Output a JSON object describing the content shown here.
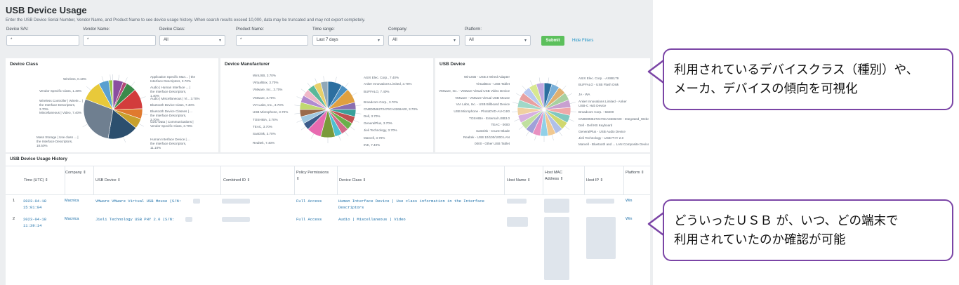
{
  "page": {
    "title": "USB Device Usage",
    "description": "Enter the USB Device Serial Number, Vendor Name, and Product Name to see device usage history. When search results exceed 10,000, data may be truncated and may not export completely."
  },
  "filters": {
    "device_sn": {
      "label": "Device S/N:",
      "value": "*"
    },
    "vendor_name": {
      "label": "Vendor Name:",
      "value": "*"
    },
    "device_class": {
      "label": "Device Class:",
      "value": "All"
    },
    "product_name": {
      "label": "Product Name:",
      "value": "*"
    },
    "time_range": {
      "label": "Time range:",
      "value": "Last 7 days"
    },
    "company": {
      "label": "Company:",
      "value": "All"
    },
    "platform": {
      "label": "Platform:",
      "value": "All"
    },
    "submit_label": "Submit",
    "hide_filters_label": "Hide Filters"
  },
  "panels": {
    "device_class": {
      "title": "Device Class",
      "left_labels": [
        "Wireless, 0.18%",
        "Vendor Specific Class, 1.40%",
        "Wireless Controller | Wirele... | the Interface Descriptors, 3.70%",
        "Miscellaneous | Video, 7.40%",
        "Mass Storage | Use class ... | the Interface Descriptors, 18.50%"
      ],
      "right_labels": [
        "Application Specific Man... | the Interface Descriptors, 3.70%",
        "Audio | Human Interface ... | the Interface Descriptors, 1.40%",
        "Audio | Miscellaneous | Vi... 3.70%",
        "Bluetooth Device Class, 7.40%",
        "Bluetooth Device Classes | ... the Interface Descriptors, 3.70%",
        "CDC-Data | Communications | Vendor Specific Class, 3.70%",
        "Human Interface Device | ... the Interface Descriptors, 11.10%"
      ]
    },
    "device_manufacturer": {
      "title": "Device Manufacturer",
      "left_labels": [
        "WinUSB, 3.70%",
        "VirtualBox, 3.70%",
        "VMware, Inc., 3.70%",
        "VMware, 3.70%",
        "VIA Labs, Inc., 3.70%",
        "USB Microphone, 3.70%",
        "TOSHIBA, 3.70%",
        "TEAC, 3.70%",
        "SanDisk, 3.70%",
        "Realtek, 7.40%"
      ],
      "right_labels": [
        "ASIX Elec. Corp., 7.40%",
        "Anker Innovations Limited, 3.70%",
        "BUFFALO, 7.40%",
        "Broadcom Corp., 3.70%",
        "CN0D0M6272476CA3266A00, 3.70%",
        "Dell, 3.70%",
        "GeneralPlus, 3.70%",
        "Jieli Technology, 3.70%",
        "Marvell, 3.70%",
        "INK, 7.40%"
      ]
    },
    "usb_device": {
      "title": "USB Device",
      "left_labels": [
        "WinUSB - USB 2 Wired Adapter",
        "VirtualBox - USB Tablet",
        "VMware, Inc. - VMware Virtual USB Video Device",
        "VMware - VMware Virtual USB Mouse",
        "VIA Labs, Inc. - USB Billboard Device",
        "USB Microphone - PhotoDVD-AU-C4I0",
        "TOSHIBA - External USB3.0",
        "TEAC - 0000",
        "SanDisk - Cruzer Blade",
        "Realtek - USB 10/100/1000 LAN",
        "0000 - Other USB Tablet"
      ],
      "right_labels": [
        "ASIX Elec. Corp. - AX88179",
        "BUFFALO - USB Flash Disk",
        "JA - WA",
        "Anker Innovations Limited - Anker USB-C Hub Device",
        "Broadcom Corp. - 58200",
        "CN0D0M6272476CA3266A00 - Integrated_Webcam_HD",
        "Dell - Dell KB Keyboard",
        "GeneralPlus - USB Audio Device",
        "Jieli Technology - USB PHY 2.0",
        "Marvell - Bluetooth and ... LAN Composite Device"
      ]
    }
  },
  "table": {
    "title": "USB Device Usage History",
    "columns": [
      "Time (UTC) ⇕",
      "Company ⇕",
      "USB Device ⇕",
      "Combined ID ⇕",
      "Policy Permissions ⇕",
      "Device Class ⇕",
      "Host Name ⇕",
      "Host MAC Address ⇕",
      "Host IP ⇕",
      "Platform ⇕"
    ],
    "rows": [
      {
        "num": "1",
        "time": "2023-04-18 15:01:04",
        "company": "Macnica",
        "usb_device": "VMware VMware Virtual USB Mouse (S/N:",
        "policy": "Full Access",
        "device_class": "Human Interface Device | Use class information in the Interface Descriptors",
        "platform": "Win"
      },
      {
        "num": "2",
        "time": "2023-04-18 11:39:14",
        "company": "Macnica",
        "usb_device": "Jieli Technology USB PHY 2.0 (S/N:",
        "policy": "Full Access",
        "device_class": "Audio | Miscellaneous | Video",
        "platform": "Win"
      }
    ]
  },
  "callouts": {
    "top": [
      "利用されているデバイスクラス（種別）や、",
      "メーカ、デバイスの傾向を可視化"
    ],
    "bottom": [
      "どういったＵＳＢ が、いつ、どの端末で",
      "利用されていたのか確認が可能"
    ]
  },
  "colors": {
    "accent_purple": "#7b45a6",
    "submit_green": "#5cc05c",
    "link_blue": "#1e93c6"
  },
  "chart_data": [
    {
      "type": "pie",
      "title": "Device Class",
      "slices": [
        {
          "label": "Application Specific Man... | the Interface Descriptors",
          "value": 3.7,
          "color": "#8a4fa0"
        },
        {
          "label": "Audio | Human Interface ... | the Interface Descriptors",
          "value": 1.4,
          "color": "#b24a78"
        },
        {
          "label": "Audio | Miscellaneous | Vi...",
          "value": 3.7,
          "color": "#3a8a4a"
        },
        {
          "label": "Bluetooth Device Class",
          "value": 7.4,
          "color": "#d23c3c"
        },
        {
          "label": "Bluetooth Device Classes | ...",
          "value": 3.7,
          "color": "#e07a2e"
        },
        {
          "label": "CDC-Data | Communications | Vendor Specific Class",
          "value": 3.7,
          "color": "#c9a02c"
        },
        {
          "label": "Human Interface Device | ... the Interface Descriptors",
          "value": 11.1,
          "color": "#2c4f6e"
        },
        {
          "label": "Mass Storage | Use class ... | the Interface Descriptors",
          "value": 18.5,
          "color": "#6f7f90"
        },
        {
          "label": "Miscellaneous | Video",
          "value": 7.4,
          "color": "#e8c93a"
        },
        {
          "label": "Wireless Controller | Wirele... | the Interface Descriptors",
          "value": 3.7,
          "color": "#5aa0d0"
        },
        {
          "label": "Vendor Specific Class",
          "value": 1.4,
          "color": "#9cc84a"
        },
        {
          "label": "Wireless",
          "value": 0.18,
          "color": "#4ec0a8"
        }
      ]
    },
    {
      "type": "pie",
      "title": "Device Manufacturer",
      "slices": [
        {
          "label": "ASIX Elec. Corp.",
          "value": 7.4,
          "color": "#2c6fa0"
        },
        {
          "label": "Anker Innovations Limited",
          "value": 3.7,
          "color": "#4a8fc0"
        },
        {
          "label": "BUFFALO",
          "value": 7.4,
          "color": "#e0a040"
        },
        {
          "label": "Broadcom Corp.",
          "value": 3.7,
          "color": "#8a6fb0"
        },
        {
          "label": "CN0D0M6272476CA3266A00",
          "value": 3.7,
          "color": "#3aa09a"
        },
        {
          "label": "Dell",
          "value": 3.7,
          "color": "#c05050"
        },
        {
          "label": "GeneralPlus",
          "value": 3.7,
          "color": "#6ab04a"
        },
        {
          "label": "Jieli Technology",
          "value": 3.7,
          "color": "#d26a8a"
        },
        {
          "label": "Marvell",
          "value": 3.7,
          "color": "#4fc0d0"
        },
        {
          "label": "INK",
          "value": 7.4,
          "color": "#7a9a3a"
        },
        {
          "label": "Realtek",
          "value": 7.4,
          "color": "#e86ab0"
        },
        {
          "label": "SanDisk",
          "value": 3.7,
          "color": "#3a5a8a"
        },
        {
          "label": "TEAC",
          "value": 3.7,
          "color": "#a0c8e0"
        },
        {
          "label": "TOSHIBA",
          "value": 3.7,
          "color": "#9a6a4a"
        },
        {
          "label": "USB Microphone",
          "value": 3.7,
          "color": "#c0d870"
        },
        {
          "label": "VIA Labs, Inc.",
          "value": 3.7,
          "color": "#b08ad0"
        },
        {
          "label": "VMware",
          "value": 3.7,
          "color": "#f0b8c8"
        },
        {
          "label": "VMware, Inc.",
          "value": 3.7,
          "color": "#5ab89a"
        },
        {
          "label": "VirtualBox",
          "value": 3.7,
          "color": "#e8d06a"
        },
        {
          "label": "WinUSB",
          "value": 3.7,
          "color": "#90a8b8"
        }
      ]
    },
    {
      "type": "pie",
      "title": "USB Device",
      "slices": [
        {
          "label": "ASIX Elec. Corp. - AX88179",
          "value": 3.7,
          "color": "#2c6fa0"
        },
        {
          "label": "BUFFALO - USB Flash Disk",
          "value": 3.7,
          "color": "#7ab0d8"
        },
        {
          "label": "JA - WA",
          "value": 3.7,
          "color": "#e0b070"
        },
        {
          "label": "Anker Innovations Limited - Anker USB-C Hub Device",
          "value": 3.7,
          "color": "#a8d0a0"
        },
        {
          "label": "Broadcom Corp. - 58200",
          "value": 3.7,
          "color": "#c8a0d0"
        },
        {
          "label": "CN0D0M6272476CA3266A00 - Integrated_Webcam_HD",
          "value": 3.7,
          "color": "#f0a8a8"
        },
        {
          "label": "Dell - Dell KB Keyboard",
          "value": 3.7,
          "color": "#80c8c0"
        },
        {
          "label": "GeneralPlus - USB Audio Device",
          "value": 3.7,
          "color": "#d0d870"
        },
        {
          "label": "Jieli Technology - USB PHY 2.0",
          "value": 3.7,
          "color": "#b0c0e8"
        },
        {
          "label": "Marvell - Bluetooth and ... LAN Composite Device",
          "value": 3.7,
          "color": "#f0c890"
        },
        {
          "label": "0000 - Other USB Tablet",
          "value": 3.7,
          "color": "#90d0e8"
        },
        {
          "label": "Realtek - USB 10/100/1000 LAN",
          "value": 3.7,
          "color": "#e890c0"
        },
        {
          "label": "SanDisk - Cruzer Blade",
          "value": 3.7,
          "color": "#a0a0d8"
        },
        {
          "label": "TEAC - 0000",
          "value": 3.7,
          "color": "#c0e0a0"
        },
        {
          "label": "TOSHIBA - External USB3.0",
          "value": 3.7,
          "color": "#d8b0e0"
        },
        {
          "label": "USB Microphone - PhotoDVD-AU-C4I0",
          "value": 3.7,
          "color": "#f0d0a0"
        },
        {
          "label": "VIA Labs, Inc. - USB Billboard Device",
          "value": 3.7,
          "color": "#a0d8c8"
        },
        {
          "label": "VMware - VMware Virtual USB Mouse",
          "value": 3.7,
          "color": "#e8a0a0"
        },
        {
          "label": "VMware, Inc. - VMware Virtual USB Video Device",
          "value": 3.7,
          "color": "#b8c8f0"
        },
        {
          "label": "VirtualBox - USB Tablet",
          "value": 3.7,
          "color": "#d8e890"
        },
        {
          "label": "WinUSB - USB 2 Wired Adapter",
          "value": 3.7,
          "color": "#c0a8e0"
        }
      ]
    }
  ]
}
